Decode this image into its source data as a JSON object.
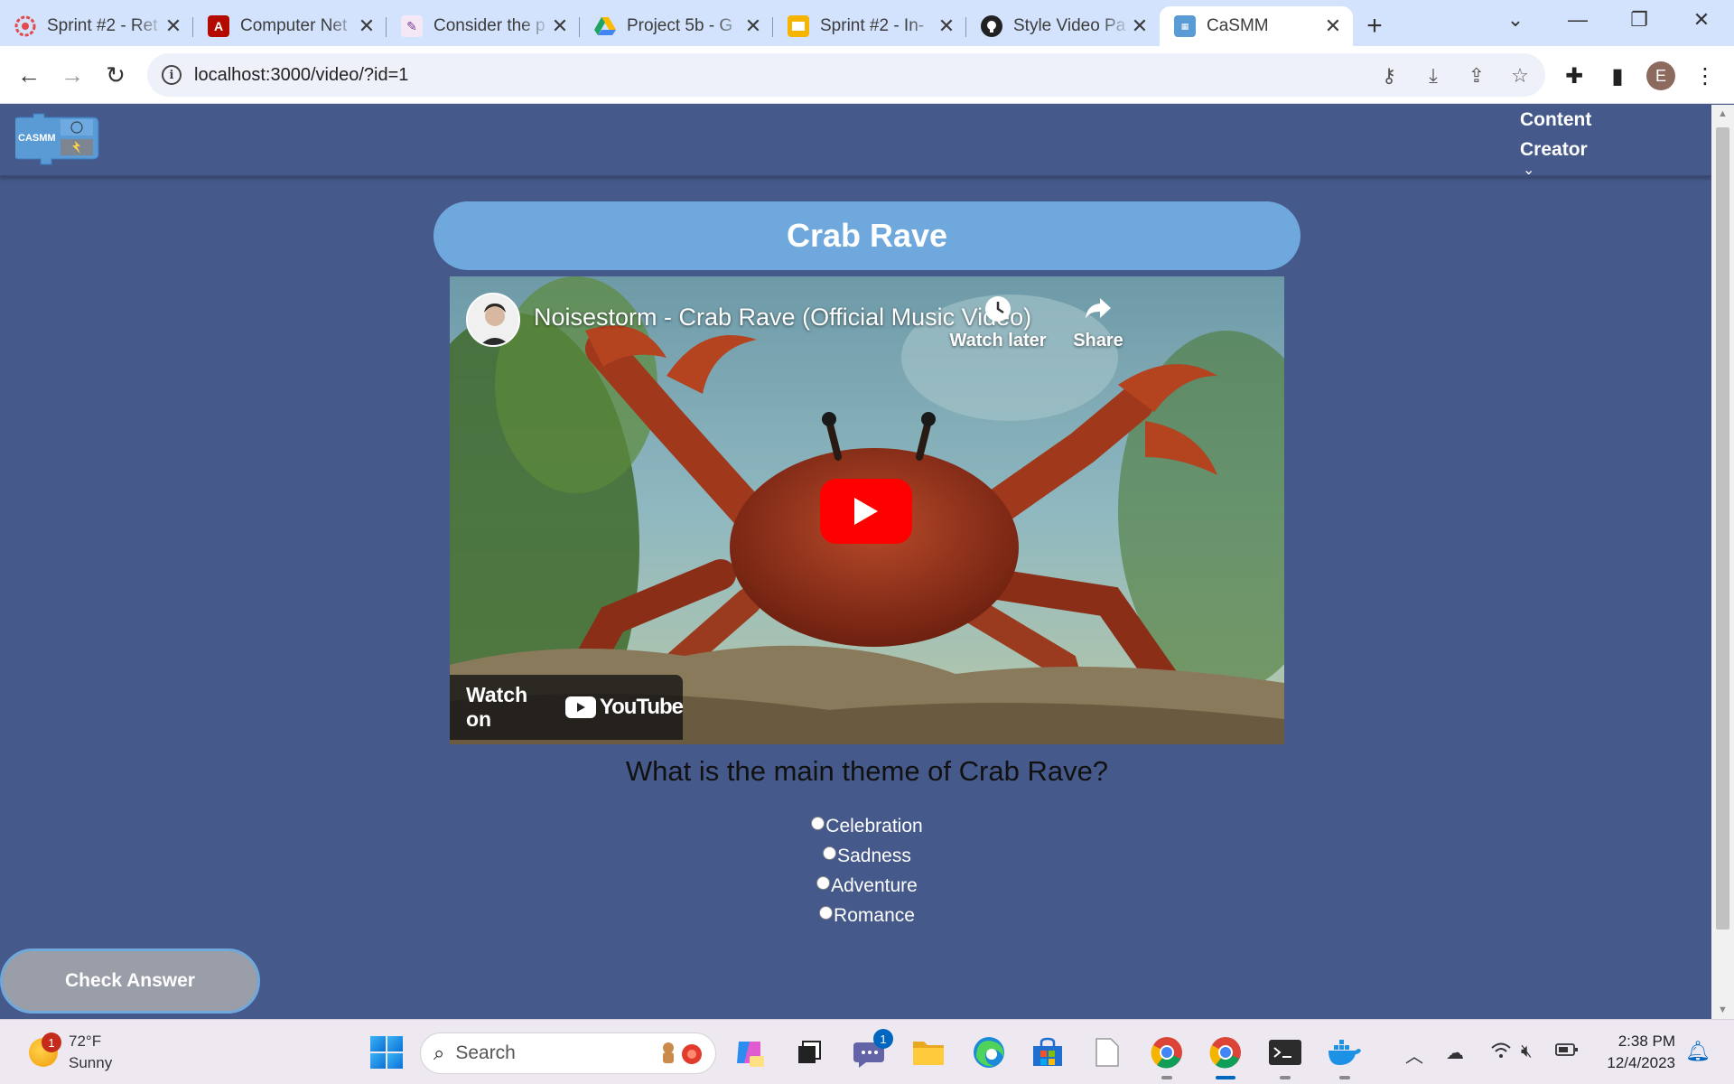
{
  "browser": {
    "tabs": [
      {
        "title": "Sprint #2 - Ret",
        "icon": "sprint-favicon-icon",
        "color": "#e24b4b"
      },
      {
        "title": "Computer Net",
        "icon": "pdf-favicon-icon",
        "color": "#b30b00"
      },
      {
        "title": "Consider the p",
        "icon": "quill-favicon-icon",
        "color": "#7a3b8f"
      },
      {
        "title": "Project 5b - G",
        "icon": "google-drive-icon",
        "color": "#1fa463"
      },
      {
        "title": "Sprint #2 - In-",
        "icon": "slides-favicon-icon",
        "color": "#f4b400"
      },
      {
        "title": "Style Video Pa",
        "icon": "github-icon",
        "color": "#222222"
      },
      {
        "title": "CaSMM",
        "icon": "casmm-favicon-icon",
        "color": "#5b9bd5",
        "active": true
      }
    ],
    "url": "localhost:3000/video/?id=1",
    "profile_initial": "E"
  },
  "app": {
    "logo_text": "CASMM",
    "user_menu": {
      "line1": "Content",
      "line2": "Creator",
      "chevron": "⌄"
    }
  },
  "video": {
    "page_title": "Crab Rave",
    "embed_title": "Noisestorm - Crab Rave (Official Music Video)",
    "watch_later_label": "Watch later",
    "share_label": "Share",
    "watch_on_label": "Watch on",
    "youtube_label": "YouTube"
  },
  "quiz": {
    "question": "What is the main theme of Crab Rave?",
    "options": [
      "Celebration",
      "Sadness",
      "Adventure",
      "Romance"
    ],
    "check_button": "Check Answer"
  },
  "taskbar": {
    "temperature": "72°F",
    "condition": "Sunny",
    "weather_badge": "1",
    "search_placeholder": "Search",
    "teams_badge": "1",
    "time": "2:38 PM",
    "date": "12/4/2023"
  },
  "colors": {
    "page_bg": "#45598a",
    "title_pill": "#6fa8dc",
    "check_button": "#9a9ea8",
    "youtube_red": "#ff0000"
  }
}
